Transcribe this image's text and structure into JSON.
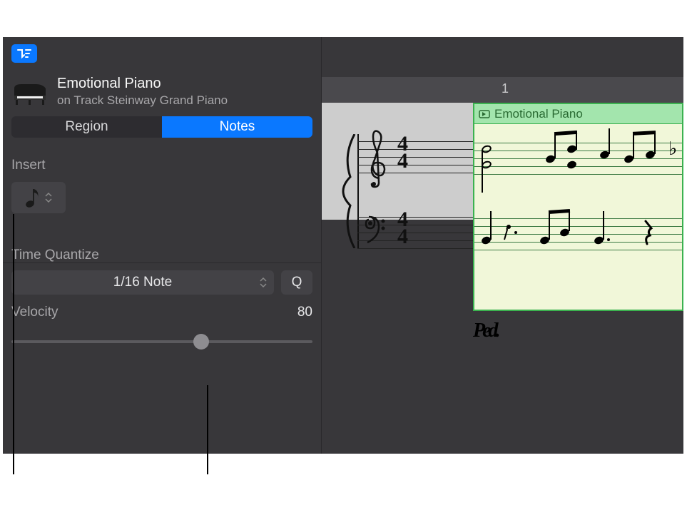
{
  "header": {
    "title": "Emotional Piano",
    "subtitle": "on Track Steinway Grand Piano"
  },
  "tabs": {
    "region": "Region",
    "notes": "Notes"
  },
  "insert": {
    "label": "Insert",
    "note_value": "eighth-note"
  },
  "time_quantize": {
    "label": "Time Quantize",
    "value": "1/16 Note",
    "q_button": "Q"
  },
  "velocity": {
    "label": "Velocity",
    "value": "80"
  },
  "ruler": {
    "bar": "1"
  },
  "region": {
    "name": "Emotional Piano"
  },
  "pedal": {
    "marking": "Ped."
  },
  "icons": {
    "filter": "filter-icon",
    "chevrons": "chevrons"
  }
}
